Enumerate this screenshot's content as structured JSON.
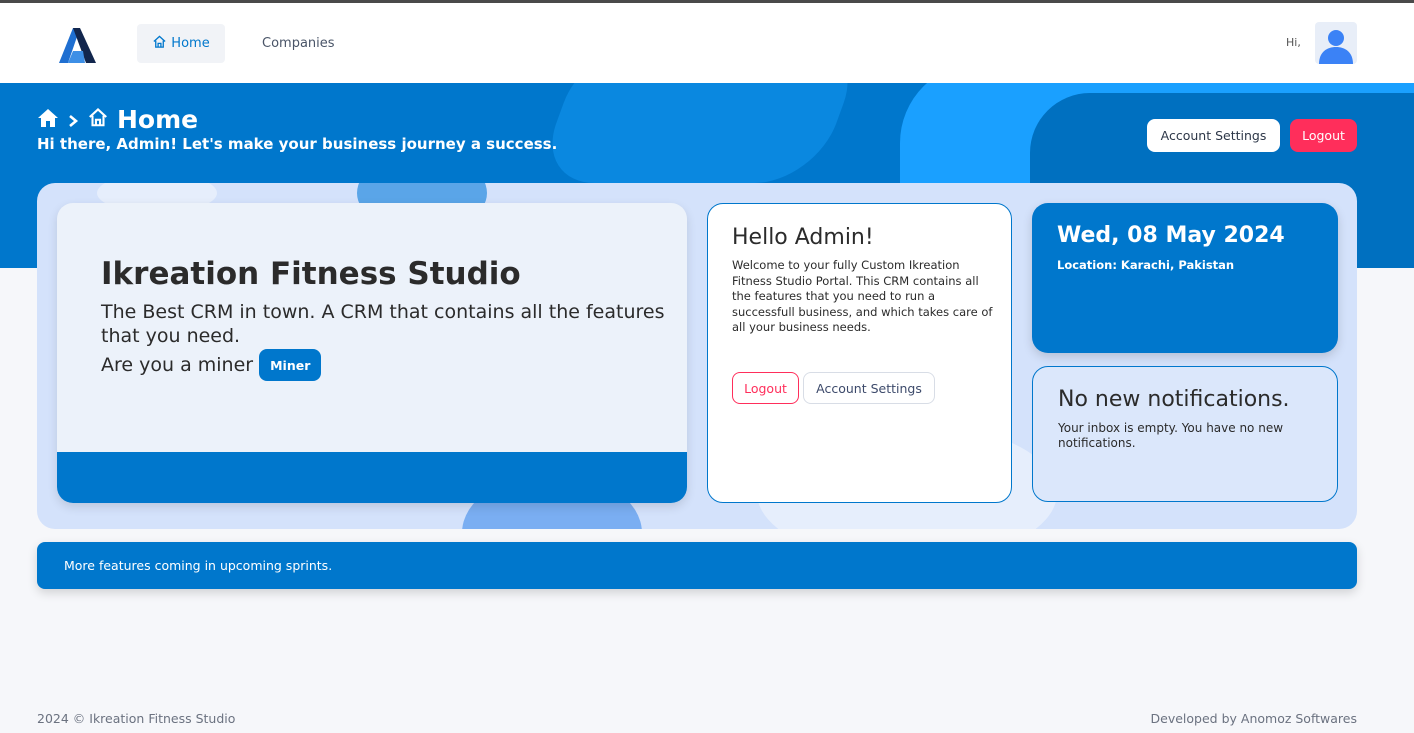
{
  "nav": {
    "home_label": "Home",
    "companies_label": "Companies",
    "greeting": "Hi,"
  },
  "hero": {
    "title": "Home",
    "subtitle": "Hi there, Admin! Let's make your business journey a success.",
    "account_settings_label": "Account Settings",
    "logout_label": "Logout"
  },
  "main_card": {
    "title": "Ikreation Fitness Studio",
    "description": "The Best CRM in town. A CRM that contains all the features that you need.",
    "miner_question": "Are you a miner",
    "miner_button": "Miner"
  },
  "hello_card": {
    "title": "Hello Admin!",
    "text": "Welcome to your fully Custom Ikreation Fitness Studio Portal. This CRM contains all the features that you need to run a successfull business, and which takes care of all your business needs.",
    "logout_label": "Logout",
    "account_settings_label": "Account Settings"
  },
  "date_card": {
    "date": "Wed, 08 May 2024",
    "location": "Location: Karachi, Pakistan"
  },
  "notifications": {
    "title": "No new notifications.",
    "text": "Your inbox is empty. You have no new notifications."
  },
  "banner": {
    "text": "More features coming in upcoming sprints."
  },
  "footer": {
    "left": "2024  © Ikreation Fitness Studio",
    "right": "Developed by Anomoz Softwares"
  },
  "colors": {
    "primary": "#0077cc",
    "danger": "#ff2e5b",
    "panel": "#d4e2fb"
  },
  "icons": [
    "app-logo-icon",
    "home-icon",
    "user-avatar-icon",
    "chevron-right-icon"
  ]
}
